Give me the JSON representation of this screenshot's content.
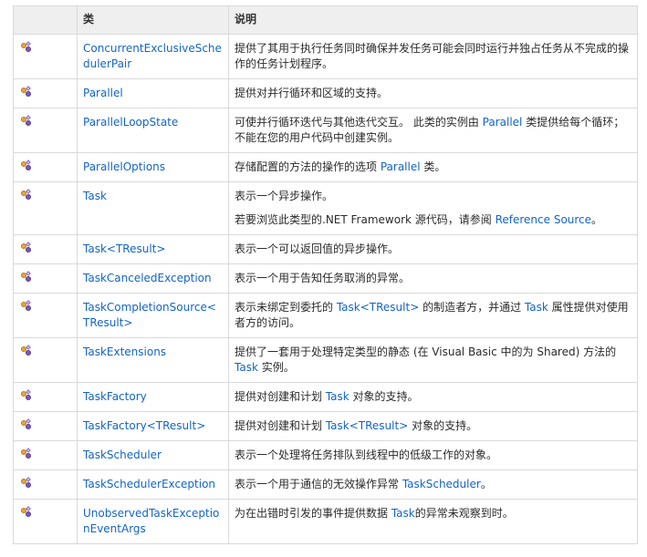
{
  "header": {
    "icon_col": "",
    "class_col": "类",
    "desc_col": "说明"
  },
  "rows": [
    {
      "name": "ConcurrentExclusiveSchedulerPair",
      "desc": [
        [
          {
            "t": "提供了其用于执行任务同时确保并发任务可能会同时运行并独占任务从不完成的操作的任务计划程序。"
          }
        ]
      ]
    },
    {
      "name": "Parallel",
      "desc": [
        [
          {
            "t": "提供对并行循环和区域的支持。"
          }
        ]
      ]
    },
    {
      "name": "ParallelLoopState",
      "desc": [
        [
          {
            "t": "可使并行循环迭代与其他迭代交互。 此类的实例由 "
          },
          {
            "l": "Parallel"
          },
          {
            "t": " 类提供给每个循环；不能在您的用户代码中创建实例。"
          }
        ]
      ]
    },
    {
      "name": "ParallelOptions",
      "desc": [
        [
          {
            "t": "存储配置的方法的操作的选项 "
          },
          {
            "l": "Parallel"
          },
          {
            "t": " 类。"
          }
        ]
      ]
    },
    {
      "name": "Task",
      "desc": [
        [
          {
            "t": "表示一个异步操作。"
          }
        ],
        [
          {
            "t": "若要浏览此类型的.NET Framework 源代码，请参阅 "
          },
          {
            "l": "Reference Source"
          },
          {
            "t": "。"
          }
        ]
      ]
    },
    {
      "name": "Task<TResult>",
      "desc": [
        [
          {
            "t": "表示一个可以返回值的异步操作。"
          }
        ]
      ]
    },
    {
      "name": "TaskCanceledException",
      "desc": [
        [
          {
            "t": "表示一个用于告知任务取消的异常。"
          }
        ]
      ]
    },
    {
      "name": "TaskCompletionSource<TResult>",
      "desc": [
        [
          {
            "t": "表示未绑定到委托的 "
          },
          {
            "l": "Task<TResult>"
          },
          {
            "t": " 的制造者方，并通过 "
          },
          {
            "l": "Task"
          },
          {
            "t": " 属性提供对使用者方的访问。"
          }
        ]
      ]
    },
    {
      "name": "TaskExtensions",
      "desc": [
        [
          {
            "t": "提供了一套用于处理特定类型的静态 (在 Visual Basic 中的为 Shared) 方法的 "
          },
          {
            "l": "Task"
          },
          {
            "t": " 实例。"
          }
        ]
      ]
    },
    {
      "name": "TaskFactory",
      "desc": [
        [
          {
            "t": "提供对创建和计划 "
          },
          {
            "l": "Task"
          },
          {
            "t": " 对象的支持。"
          }
        ]
      ]
    },
    {
      "name": "TaskFactory<TResult>",
      "desc": [
        [
          {
            "t": "提供对创建和计划 "
          },
          {
            "l": "Task<TResult>"
          },
          {
            "t": " 对象的支持。"
          }
        ]
      ]
    },
    {
      "name": "TaskScheduler",
      "desc": [
        [
          {
            "t": "表示一个处理将任务排队到线程中的低级工作的对象。"
          }
        ]
      ]
    },
    {
      "name": "TaskSchedulerException",
      "desc": [
        [
          {
            "t": "表示一个用于通信的无效操作异常 "
          },
          {
            "l": "TaskScheduler"
          },
          {
            "t": "。"
          }
        ]
      ]
    },
    {
      "name": "UnobservedTaskExceptionEventArgs",
      "desc": [
        [
          {
            "t": "为在出错时引发的事件提供数据 "
          },
          {
            "l": "Task"
          },
          {
            "t": "的异常未观察到时。"
          }
        ]
      ]
    }
  ],
  "icon_name": "class-icon",
  "colors": {
    "link": "#1364c4",
    "header_bg": "#efefef",
    "border": "#d9d9d9",
    "text": "#2a2a2a"
  }
}
